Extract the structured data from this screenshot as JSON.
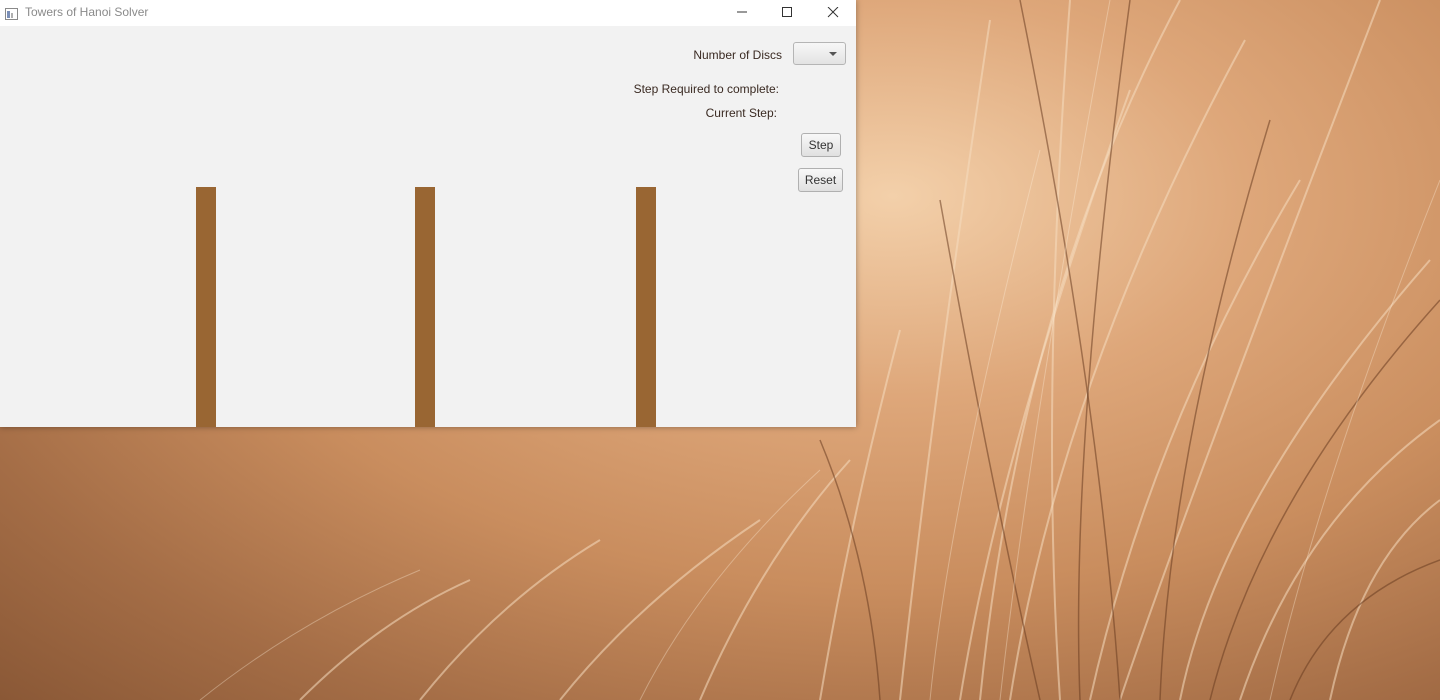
{
  "window": {
    "title": "Towers of Hanoi Solver",
    "controls": {
      "minimize_icon": "minimize-icon",
      "maximize_icon": "maximize-icon",
      "close_icon": "close-icon"
    }
  },
  "controls": {
    "discs_label": "Number of Discs",
    "discs_selected": "",
    "steps_required_label": "Step Required to complete:",
    "current_step_label": "Current Step:",
    "step_button": "Step",
    "reset_button": "Reset"
  },
  "board": {
    "peg_color": "#996633",
    "peg_count": 3
  },
  "colors": {
    "window_background": "#f2f2f2",
    "titlebar_background": "#ffffff",
    "label_text": "#3a2a22"
  }
}
